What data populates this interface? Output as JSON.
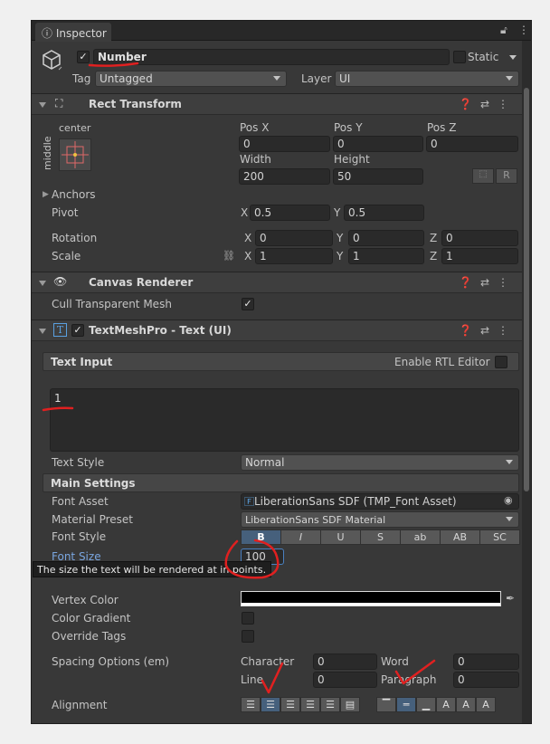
{
  "tab": {
    "title": "Inspector"
  },
  "object": {
    "name": "Number",
    "static_label": "Static",
    "tag_label": "Tag",
    "tag_value": "Untagged",
    "layer_label": "Layer",
    "layer_value": "UI"
  },
  "rect_transform": {
    "title": "Rect Transform",
    "anchor_h": "center",
    "anchor_v": "middle",
    "pos_x_label": "Pos X",
    "pos_y_label": "Pos Y",
    "pos_z_label": "Pos Z",
    "pos_x": "0",
    "pos_y": "0",
    "pos_z": "0",
    "width_label": "Width",
    "height_label": "Height",
    "width": "200",
    "height": "50",
    "r_label": "R",
    "anchors_label": "Anchors",
    "pivot_label": "Pivot",
    "x_label": "X",
    "y_label": "Y",
    "z_label": "Z",
    "pivot_x": "0.5",
    "pivot_y": "0.5",
    "rotation_label": "Rotation",
    "rot_x": "0",
    "rot_y": "0",
    "rot_z": "0",
    "scale_label": "Scale",
    "scale_x": "1",
    "scale_y": "1",
    "scale_z": "1"
  },
  "canvas_renderer": {
    "title": "Canvas Renderer",
    "cull_label": "Cull Transparent Mesh"
  },
  "tmp": {
    "title": "TextMeshPro - Text (UI)",
    "text_input_label": "Text Input",
    "rtl_label": "Enable RTL Editor",
    "text_value": "1",
    "text_style_label": "Text Style",
    "text_style_value": "Normal",
    "main_settings_label": "Main Settings",
    "font_asset_label": "Font Asset",
    "font_asset_value": "LiberationSans SDF (TMP_Font Asset)",
    "material_label": "Material Preset",
    "material_value": "LiberationSans SDF Material",
    "font_style_label": "Font Style",
    "font_style_buttons": [
      "B",
      "I",
      "U",
      "S",
      "ab",
      "AB",
      "SC"
    ],
    "font_size_label": "Font Size",
    "font_size_value": "100",
    "tooltip": "The size the text will be rendered at in points.",
    "vertex_color_label": "Vertex Color",
    "color_gradient_label": "Color Gradient",
    "override_tags_label": "Override Tags",
    "spacing_label": "Spacing Options (em)",
    "character_label": "Character",
    "character_value": "0",
    "word_label": "Word",
    "word_value": "0",
    "line_label": "Line",
    "line_value": "0",
    "paragraph_label": "Paragraph",
    "paragraph_value": "0",
    "alignment_label": "Alignment"
  },
  "colors": {
    "accent": "#46607c",
    "annotation": "#e02020"
  }
}
